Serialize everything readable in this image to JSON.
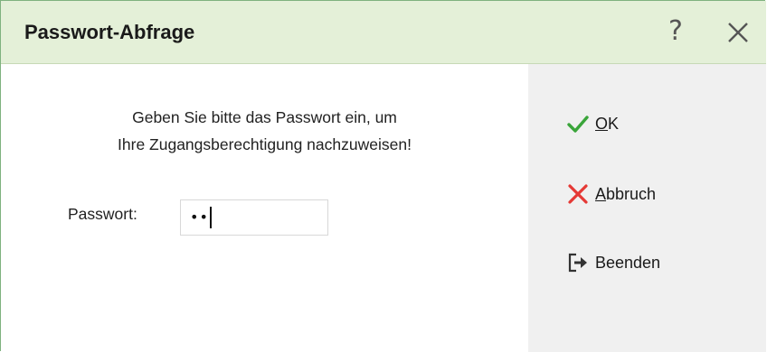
{
  "window": {
    "title": "Passwort-Abfrage",
    "help_label": "?"
  },
  "prompt": {
    "line1": "Geben Sie bitte das Passwort ein, um",
    "line2": "Ihre Zugangsberechtigung nachzuweisen!"
  },
  "password": {
    "label": "Passwort:",
    "masked_value": "••"
  },
  "actions": {
    "ok": {
      "mnemonic": "O",
      "rest": "K"
    },
    "cancel": {
      "mnemonic": "A",
      "rest": "bbruch"
    },
    "quit": {
      "label": "Beenden"
    }
  },
  "colors": {
    "titlebar_bg": "#e4f0d8",
    "border": "#7fb27f",
    "ok_icon": "#3aa53a",
    "cancel_icon": "#e53935",
    "side_panel_bg": "#f0f0f0"
  }
}
